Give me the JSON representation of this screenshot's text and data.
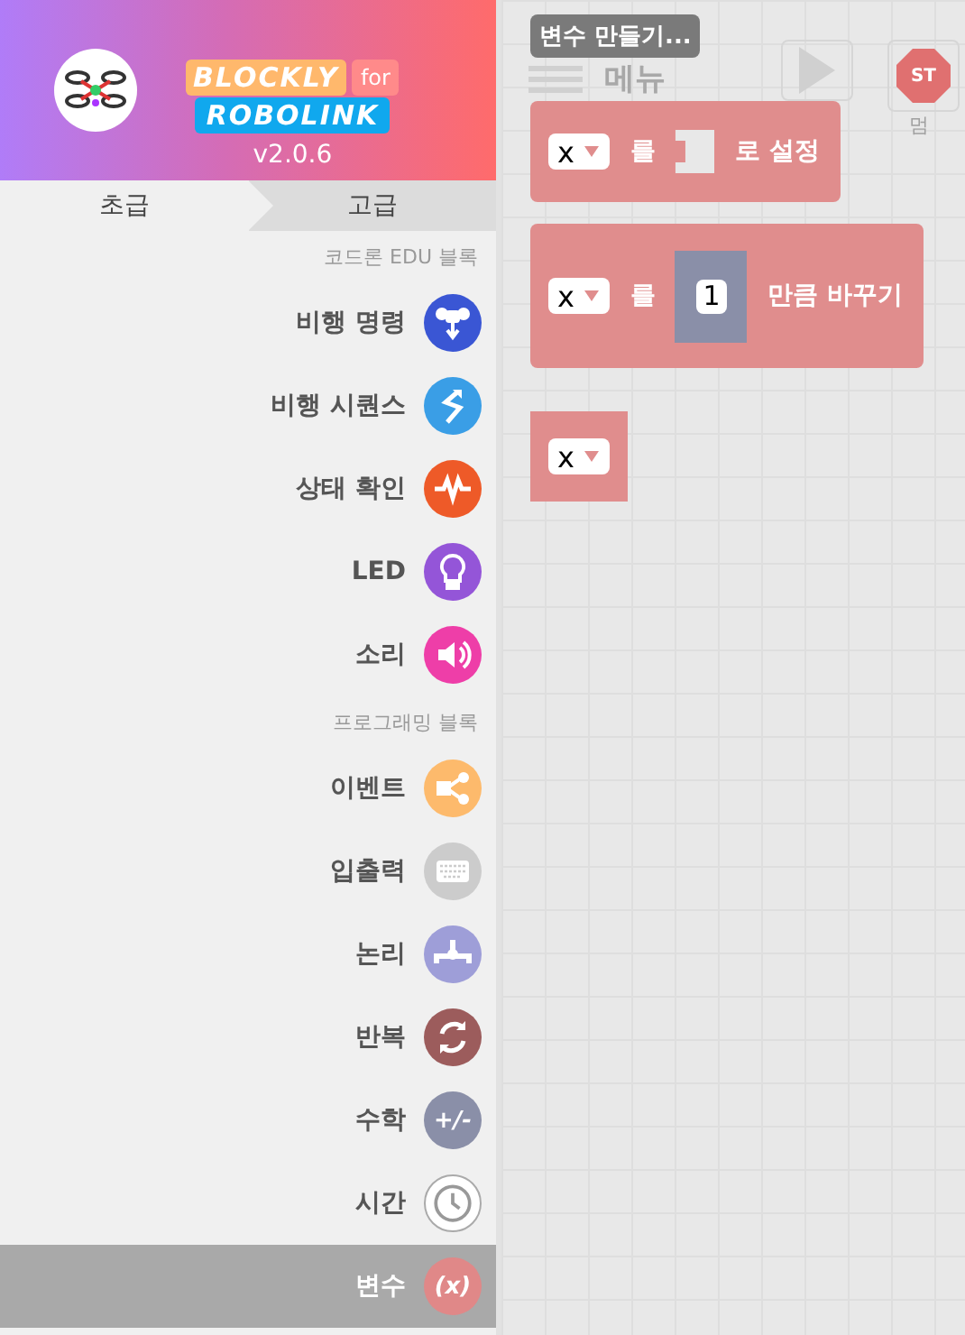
{
  "header": {
    "version": "v2.0.6",
    "logo": {
      "top": "BLOCKLY",
      "for": "for",
      "bottom": "ROBOLINK"
    }
  },
  "tabs": [
    {
      "label": "초급",
      "selected": true
    },
    {
      "label": "고급",
      "selected": false
    }
  ],
  "sections": [
    {
      "title": "코드론 EDU 블록",
      "categories": [
        {
          "label": "비행 명령",
          "kind": "drone",
          "color": "#3a56d4",
          "selected": false
        },
        {
          "label": "비행 시퀀스",
          "kind": "sequence",
          "color": "#3a9ee6",
          "selected": false
        },
        {
          "label": "상태 확인",
          "kind": "pulse",
          "color": "#ee5a28",
          "selected": false
        },
        {
          "label": "LED",
          "kind": "bulb",
          "color": "#9455d8",
          "selected": false
        },
        {
          "label": "소리",
          "kind": "speaker",
          "color": "#ee3ea8",
          "selected": false
        }
      ]
    },
    {
      "title": "프로그래밍 블록",
      "categories": [
        {
          "label": "이벤트",
          "kind": "share",
          "color": "#fdba6c",
          "selected": false
        },
        {
          "label": "입출력",
          "kind": "keyboard",
          "color": "#cccccc",
          "selected": false
        },
        {
          "label": "논리",
          "kind": "logic",
          "color": "#9e9ed8",
          "selected": false
        },
        {
          "label": "반복",
          "kind": "loop",
          "color": "#9c5c5c",
          "selected": false
        },
        {
          "label": "수학",
          "kind": "glyph",
          "icon_text": "+/-",
          "color": "#8a8fa8",
          "selected": false
        },
        {
          "label": "시간",
          "kind": "clock",
          "color": "#ffffff",
          "selected": false
        },
        {
          "label": "변수",
          "kind": "glyph",
          "icon_text": "(x)",
          "color": "#e08888",
          "selected": true
        }
      ]
    }
  ],
  "toolbar": {
    "menu": "메뉴",
    "stop_sign": "ST",
    "stop": "멈"
  },
  "flyout": {
    "create_button": "변수 만들기...",
    "blocks": [
      {
        "kind": "set",
        "variable": "x",
        "parts": [
          "를",
          "로 설정"
        ]
      },
      {
        "kind": "change",
        "variable": "x",
        "parts": [
          "를",
          "만큼 바꾸기"
        ],
        "number": "1"
      },
      {
        "kind": "get",
        "variable": "x"
      }
    ]
  }
}
